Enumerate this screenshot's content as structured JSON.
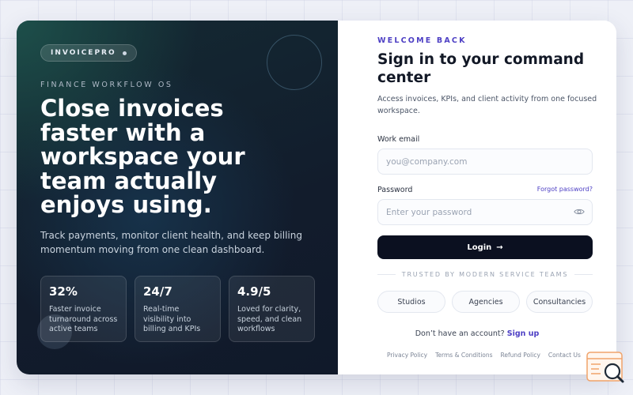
{
  "brand": {
    "name": "INVOICEPRO"
  },
  "hero": {
    "eyebrow": "FINANCE WORKFLOW OS",
    "headline": "Close invoices faster with a workspace your team actually enjoys using.",
    "subcopy": "Track payments, monitor client health, and keep billing momentum moving from one clean dashboard."
  },
  "stats": [
    {
      "value": "32%",
      "label": "Faster invoice turnaround across active teams"
    },
    {
      "value": "24/7",
      "label": "Real-time visibility into billing and KPIs"
    },
    {
      "value": "4.9/5",
      "label": "Loved for clarity, speed, and clean workflows"
    }
  ],
  "login": {
    "eyebrow": "WELCOME BACK",
    "title": "Sign in to your command center",
    "subtitle": "Access invoices, KPIs, and client activity from one focused workspace.",
    "email_label": "Work email",
    "email_placeholder": "you@company.com",
    "password_label": "Password",
    "forgot_label": "Forgot password?",
    "password_placeholder": "Enter your password",
    "button_label": "Login",
    "button_arrow": "→",
    "trusted_label": "TRUSTED BY MODERN SERVICE TEAMS",
    "chips": [
      "Studios",
      "Agencies",
      "Consultancies"
    ],
    "signup_prompt": "Don’t have an account?",
    "signup_link": "Sign up",
    "footer_links": [
      "Privacy Policy",
      "Terms & Conditions",
      "Refund Policy",
      "Contact Us"
    ]
  },
  "colors": {
    "accent": "#4d3fc4",
    "button": "#0b1020",
    "hero_bg": "#121c2c"
  },
  "icons": [
    "eye-icon",
    "search-badge-icon"
  ]
}
